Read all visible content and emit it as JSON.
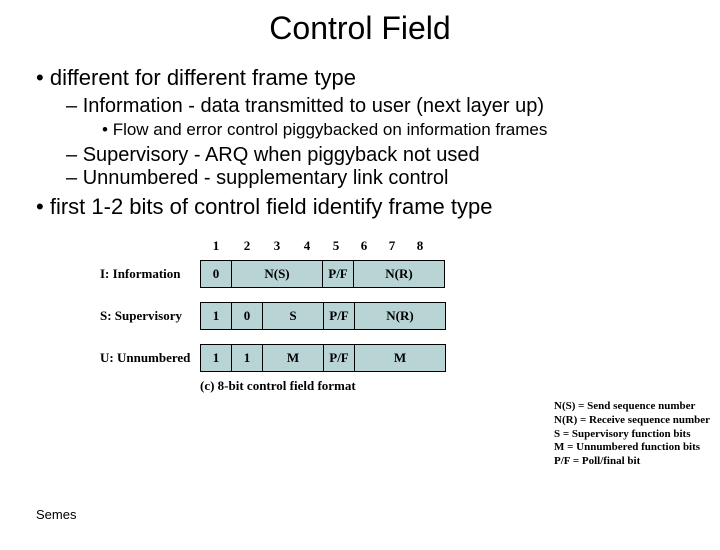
{
  "title": "Control Field",
  "bullets": {
    "b1": "different for different frame type",
    "b1a": "Information - data transmitted to user (next layer up)",
    "b1a1": "Flow and error control piggybacked on information frames",
    "b1b": "Supervisory - ARQ when piggyback not used",
    "b1c": "Unnumbered - supplementary link control",
    "b2": "first 1-2 bits of control field identify frame type"
  },
  "cols": {
    "c1": "1",
    "c2": "2",
    "c3": "3",
    "c4": "4",
    "c5": "5",
    "c6": "6",
    "c7": "7",
    "c8": "8"
  },
  "rows": {
    "info": {
      "label": "I: Information",
      "f1": "0",
      "f2": "N(S)",
      "f3": "P/F",
      "f4": "N(R)"
    },
    "sup": {
      "label": "S: Supervisory",
      "f1": "1",
      "f1b": "0",
      "f2": "S",
      "f3": "P/F",
      "f4": "N(R)"
    },
    "unn": {
      "label": "U: Unnumbered",
      "f1": "1",
      "f1b": "1",
      "f2": "M",
      "f3": "P/F",
      "f4": "M"
    }
  },
  "legend": {
    "l1": "N(S) = Send sequence number",
    "l2": "N(R) = Receive sequence number",
    "l3": "S = Supervisory function bits",
    "l4": "M = Unnumbered function bits",
    "l5": "P/F = Poll/final bit"
  },
  "caption": "(c) 8-bit control field format",
  "footer": "Semes"
}
